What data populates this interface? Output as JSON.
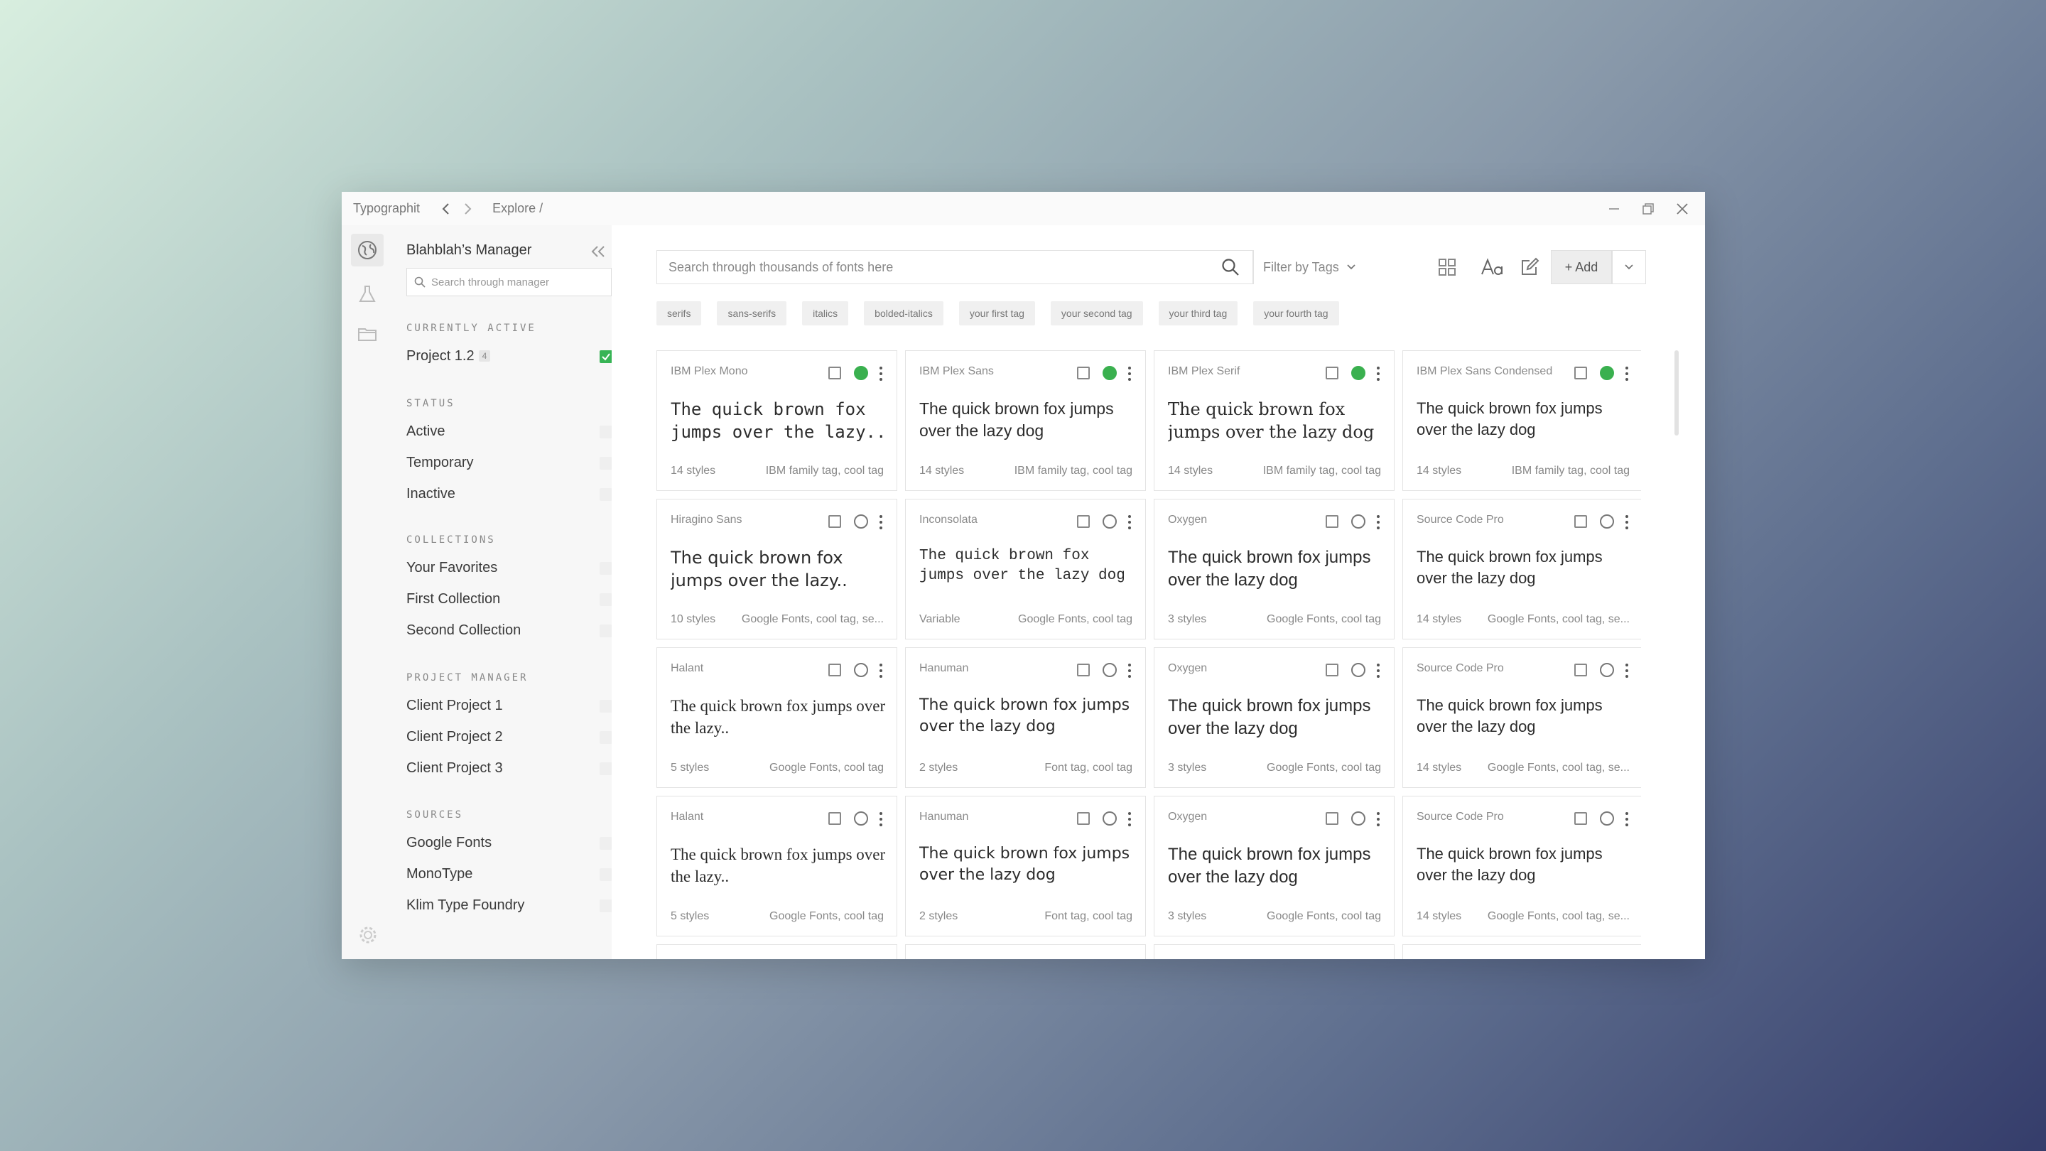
{
  "titlebar": {
    "app_name": "Typographit",
    "breadcrumb": "Explore /"
  },
  "sidebar": {
    "title": "Blahblah’s Manager",
    "search_placeholder": "Search through manager",
    "sections": {
      "currently_active": "CURRENTLY ACTIVE",
      "status": "STATUS",
      "collections": "COLLECTIONS",
      "project_manager": "PROJECT MANAGER",
      "sources": "SOURCES"
    },
    "active_project": {
      "label": "Project 1.2",
      "count": "4",
      "checked": true
    },
    "status_items": [
      "Active",
      "Temporary",
      "Inactive"
    ],
    "collection_items": [
      "Your Favorites",
      "First Collection",
      "Second Collection"
    ],
    "project_items": [
      "Client Project 1",
      "Client Project 2",
      "Client Project 3"
    ],
    "source_items": [
      "Google Fonts",
      "MonoType",
      "Klim Type Foundry"
    ]
  },
  "toolbar": {
    "search_placeholder": "Search through thousands of fonts here",
    "filter_label": "Filter by Tags",
    "add_label": "+ Add"
  },
  "tags": [
    "serifs",
    "sans-serifs",
    "italics",
    "bolded-italics",
    "your first tag",
    "your second tag",
    "your third tag",
    "your fourth tag"
  ],
  "cards": [
    {
      "name": "IBM Plex Mono",
      "sample": "The quick brown fox jumps over the lazy..",
      "styles": "14 styles",
      "tags": "IBM family tag, cool tag",
      "active": true
    },
    {
      "name": "IBM Plex Sans",
      "sample": "The quick brown fox jumps over the lazy dog",
      "styles": "14 styles",
      "tags": "IBM family tag, cool tag",
      "active": true
    },
    {
      "name": "IBM Plex Serif",
      "sample": "The quick brown fox jumps over the lazy dog",
      "styles": "14 styles",
      "tags": "IBM family tag, cool tag",
      "active": true
    },
    {
      "name": "IBM Plex Sans Condensed",
      "sample": "The quick brown fox jumps over the lazy dog",
      "styles": "14 styles",
      "tags": "IBM family tag, cool tag",
      "active": true
    },
    {
      "name": "Hiragino Sans",
      "sample": "The quick brown fox jumps over the lazy..",
      "styles": "10 styles",
      "tags": "Google Fonts, cool tag, se...",
      "active": false
    },
    {
      "name": "Inconsolata",
      "sample": "The quick brown fox jumps over the lazy dog",
      "styles": "Variable",
      "tags": "Google Fonts, cool tag",
      "active": false
    },
    {
      "name": "Oxygen",
      "sample": "The quick brown fox jumps over the lazy dog",
      "styles": "3 styles",
      "tags": "Google Fonts, cool tag",
      "active": false
    },
    {
      "name": "Source Code Pro",
      "sample": "The quick brown fox jumps over the lazy dog",
      "styles": "14 styles",
      "tags": "Google Fonts, cool tag, se...",
      "active": false
    },
    {
      "name": "Halant",
      "sample": "The quick brown fox jumps over the lazy..",
      "styles": "5 styles",
      "tags": "Google Fonts, cool tag",
      "active": false
    },
    {
      "name": "Hanuman",
      "sample": "The quick brown fox jumps over the lazy dog",
      "styles": "2 styles",
      "tags": "Font tag, cool tag",
      "active": false
    },
    {
      "name": "Oxygen",
      "sample": "The quick brown fox jumps over the lazy dog",
      "styles": "3 styles",
      "tags": "Google Fonts, cool tag",
      "active": false
    },
    {
      "name": "Source Code Pro",
      "sample": "The quick brown fox jumps over the lazy dog",
      "styles": "14 styles",
      "tags": "Google Fonts, cool tag, se...",
      "active": false
    },
    {
      "name": "Halant",
      "sample": "The quick brown fox jumps over the lazy..",
      "styles": "5 styles",
      "tags": "Google Fonts, cool tag",
      "active": false
    },
    {
      "name": "Hanuman",
      "sample": "The quick brown fox jumps over the lazy dog",
      "styles": "2 styles",
      "tags": "Font tag, cool tag",
      "active": false
    },
    {
      "name": "Oxygen",
      "sample": "The quick brown fox jumps over the lazy dog",
      "styles": "3 styles",
      "tags": "Google Fonts, cool tag",
      "active": false
    },
    {
      "name": "Source Code Pro",
      "sample": "The quick brown fox jumps over the lazy dog",
      "styles": "14 styles",
      "tags": "Google Fonts, cool tag, se...",
      "active": false
    }
  ],
  "colors": {
    "accent_green": "#37b455",
    "sidebar_bg": "#f7f7f7"
  }
}
